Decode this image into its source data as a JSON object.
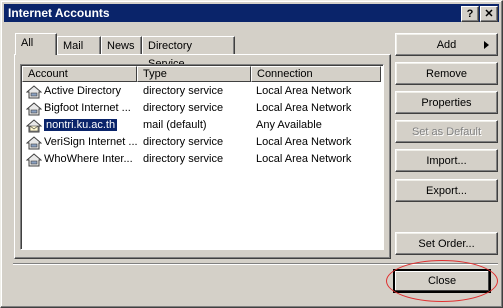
{
  "window": {
    "title": "Internet Accounts",
    "help_glyph": "?",
    "close_glyph": "✕"
  },
  "tabs": [
    {
      "label": "All",
      "active": true
    },
    {
      "label": "Mail",
      "active": false
    },
    {
      "label": "News",
      "active": false
    },
    {
      "label": "Directory Service",
      "active": false
    }
  ],
  "list": {
    "columns": [
      "Account",
      "Type",
      "Connection"
    ],
    "rows": [
      {
        "account": "Active Directory",
        "type": "directory service",
        "connection": "Local Area Network",
        "icon": "directory-service-icon"
      },
      {
        "account": "Bigfoot Internet ...",
        "type": "directory service",
        "connection": "Local Area Network",
        "icon": "directory-service-icon"
      },
      {
        "account": "nontri.ku.ac.th",
        "type": "mail (default)",
        "connection": "Any Available",
        "icon": "mail-account-icon",
        "selected": true
      },
      {
        "account": "VeriSign Internet ...",
        "type": "directory service",
        "connection": "Local Area Network",
        "icon": "directory-service-icon"
      },
      {
        "account": "WhoWhere Inter...",
        "type": "directory service",
        "connection": "Local Area Network",
        "icon": "directory-service-icon"
      }
    ]
  },
  "buttons": {
    "add": "Add",
    "remove": "Remove",
    "properties": "Properties",
    "set_default": "Set as Default",
    "import": "Import...",
    "export": "Export...",
    "set_order": "Set Order...",
    "close": "Close"
  },
  "colors": {
    "title_bar": "#0a246a",
    "face": "#d4d0c8",
    "selection": "#0a246a",
    "annotation": "#e03030"
  }
}
